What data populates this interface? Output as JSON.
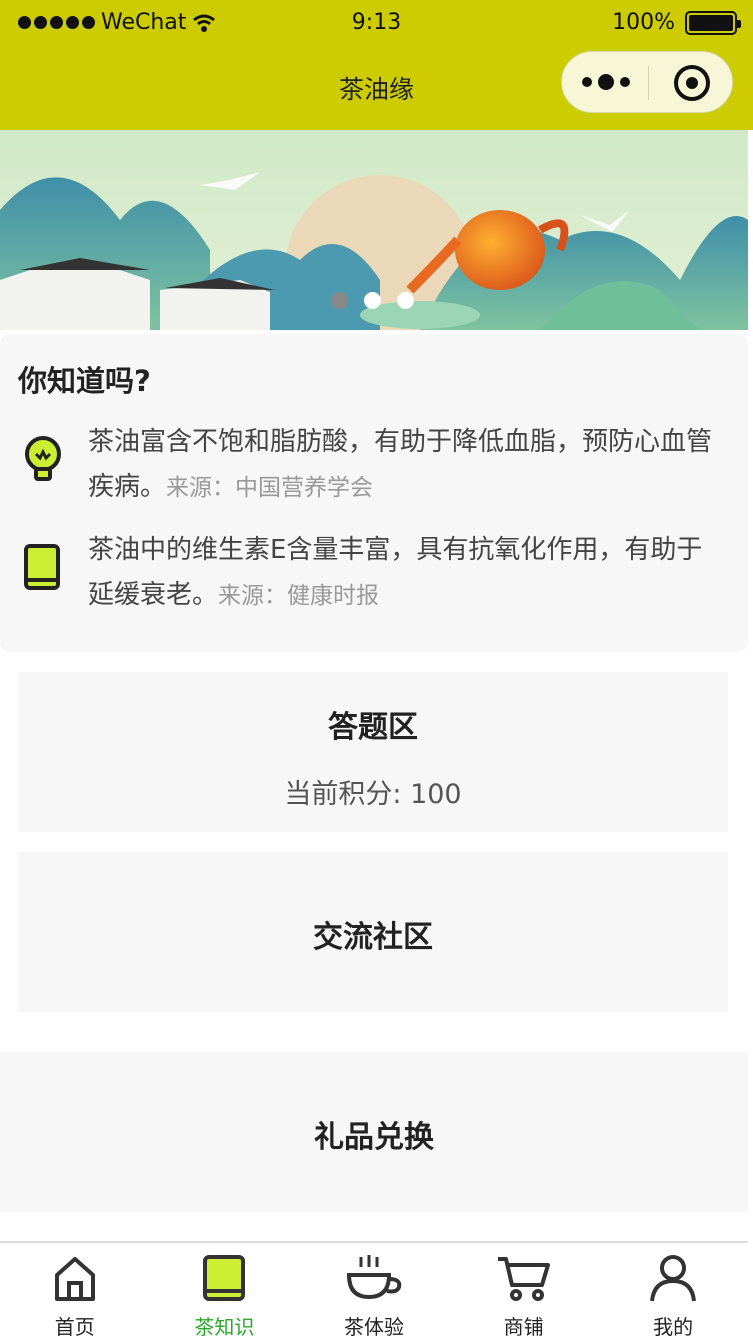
{
  "status_bar": {
    "carrier": "WeChat",
    "time": "9:13",
    "battery": "100%",
    "battery_level": 1.0
  },
  "nav": {
    "title": "茶油缘",
    "more_icon": "more-dots-icon",
    "close_icon": "target-circle-icon"
  },
  "banner": {
    "slides": 3,
    "active_slide": 0
  },
  "did_you_know": {
    "heading": "你知道吗?",
    "facts": [
      {
        "icon": "lightbulb-icon",
        "text": "茶油富含不饱和脂肪酸，有助于降低血脂，预防心血管疾病。",
        "source": "来源：中国营养学会"
      },
      {
        "icon": "book-icon",
        "text": "茶油中的维生素E含量丰富，具有抗氧化作用，有助于延缓衰老。",
        "source": "来源：健康时报"
      }
    ]
  },
  "quiz": {
    "title": "答题区",
    "score_text": "当前积分: 100"
  },
  "community": {
    "title": "交流社区"
  },
  "gifts": {
    "title": "礼品兑换"
  },
  "tabbar": {
    "items": [
      {
        "label": "首页",
        "icon": "home-icon"
      },
      {
        "label": "茶知识",
        "icon": "book-icon"
      },
      {
        "label": "茶体验",
        "icon": "tea-cup-icon"
      },
      {
        "label": "商铺",
        "icon": "cart-icon"
      },
      {
        "label": "我的",
        "icon": "user-icon"
      }
    ],
    "active_index": 1,
    "active_color": "#2ba82b",
    "accent_color": "#ccee33"
  },
  "colors": {
    "nav_background": "#cccc00",
    "card_background": "#f7f7f7"
  }
}
